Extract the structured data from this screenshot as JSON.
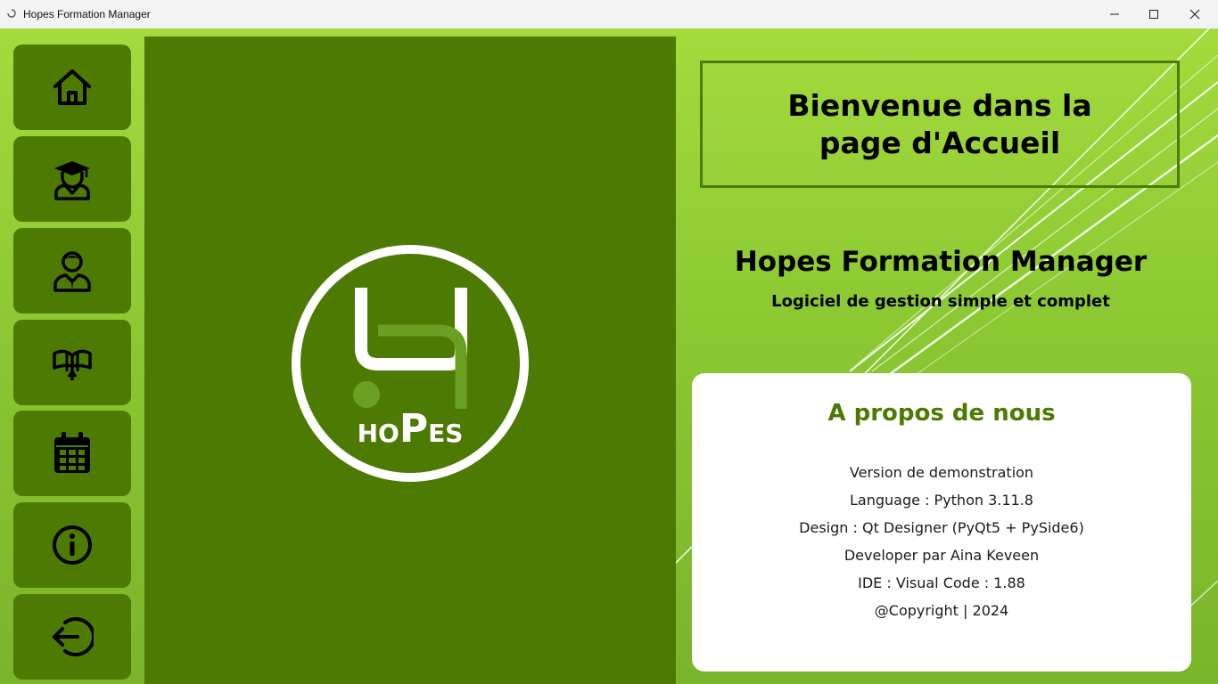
{
  "window": {
    "title": "Hopes Formation Manager"
  },
  "sidebar": {
    "items": [
      {
        "icon": "home-icon"
      },
      {
        "icon": "graduate-icon"
      },
      {
        "icon": "teacher-icon"
      },
      {
        "icon": "gift-icon"
      },
      {
        "icon": "calendar-icon"
      },
      {
        "icon": "info-icon"
      },
      {
        "icon": "logout-icon"
      }
    ]
  },
  "logo": {
    "text_small_1": "HO",
    "text_big": "P",
    "text_small_2": "ES"
  },
  "welcome": {
    "title": "Bienvenue dans la page d'Accueil"
  },
  "app": {
    "name": "Hopes Formation Manager",
    "tagline": "Logiciel de gestion simple et complet"
  },
  "about": {
    "title": "A propos de nous",
    "lines": [
      "Version de demonstration",
      "Language : Python 3.11.8",
      "Design : Qt Designer (PyQt5 + PySide6)",
      "Developer par Aina Keveen",
      "IDE : Visual Code : 1.88",
      "@Copyright | 2024"
    ]
  },
  "colors": {
    "accent_dark": "#4d7a02",
    "background_light": "#a4db3d",
    "card": "#ffffff"
  }
}
